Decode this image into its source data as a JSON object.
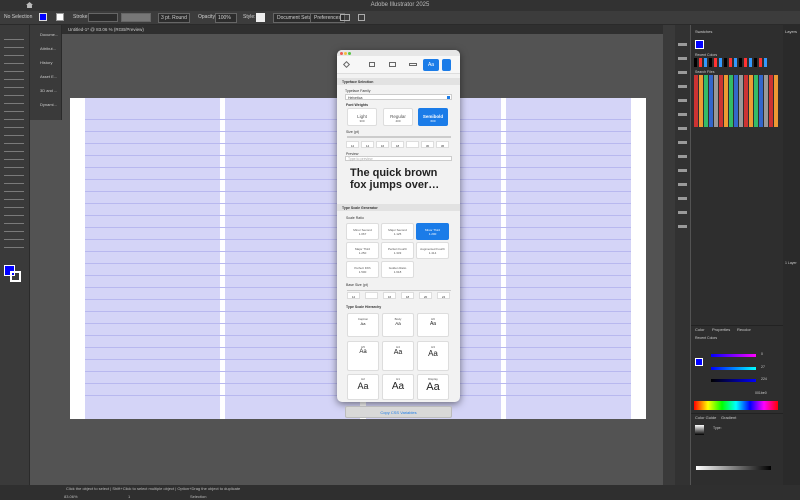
{
  "app": {
    "title": "Adobe Illustrator 2025"
  },
  "control_bar": {
    "selection": "No Selection",
    "stroke_label": "Stroke:",
    "stroke_profile": "3 pt. Round",
    "opacity_label": "Opacity:",
    "opacity_value": "100%",
    "style_label": "Style:",
    "doc_setup": "Document Setup",
    "preferences": "Preferences"
  },
  "doc_tab": {
    "label": "Untitled-1* @ 83.06 % (RGB/Preview)"
  },
  "left_panels": [
    "Docume...",
    "Attribut...",
    "History",
    "Asset E...",
    "3D and ...",
    "Dynami..."
  ],
  "plugin": {
    "section1": "Typeface Selection",
    "family_label": "Typeface Family",
    "family_value": "Helvetica",
    "weights_label": "Font Weights",
    "weights": [
      {
        "name": "Light",
        "val": "300"
      },
      {
        "name": "Regular",
        "val": "400"
      },
      {
        "name": "Semibold",
        "val": "600"
      }
    ],
    "size_label": "Size (pt)",
    "sizes": [
      "12",
      "14",
      "16",
      "18",
      "24",
      "30",
      "36"
    ],
    "preview_label": "Preview",
    "preview_placeholder": "Type to preview",
    "sample": "The quick brown fox jumps over…",
    "section2": "Type Scale Generator",
    "scale_label": "Scale Ratio",
    "ratios": [
      {
        "name": "Minor Second",
        "val": "1.067"
      },
      {
        "name": "Major Second",
        "val": "1.125"
      },
      {
        "name": "Minor Third",
        "val": "1.200"
      },
      {
        "name": "Major Third",
        "val": "1.250"
      },
      {
        "name": "Perfect Fourth",
        "val": "1.333"
      },
      {
        "name": "Augmented Fourth",
        "val": "1.414"
      },
      {
        "name": "Perfect Fifth",
        "val": "1.500"
      },
      {
        "name": "Golden Ratio",
        "val": "1.618"
      }
    ],
    "base_label": "Base Size (pt)",
    "bases": [
      "12",
      "14",
      "16",
      "18",
      "20",
      "24"
    ],
    "hierarchy_label": "Type Scale Hierarchy",
    "levels": [
      "Caption",
      "Body",
      "H6",
      "H5",
      "H4",
      "H3",
      "H2",
      "H1",
      "Display"
    ],
    "sample_small": "Aa",
    "copy_btn": "Copy CSS Variables"
  },
  "right": {
    "swatches_tab": "Swatches",
    "layers_tab": "Layers",
    "recent_colors": "Recent Colors",
    "search": "Search Files",
    "color_tab": "Color",
    "properties_tab": "Properties",
    "recolor_tab": "Recolor",
    "recent2": "Recent Colors",
    "r": "0",
    "g": "27",
    "b": "224",
    "hex": "001be0",
    "guide_tab": "Color Guide",
    "gradient_tab": "Gradient",
    "type_label": "Type:",
    "layer1": "1 Layer"
  },
  "status": {
    "zoom": "83.06%",
    "page": "1",
    "mode": "Selection",
    "hint": "Click the object to select | Shift+Click to select multiple object | Option+Drag the object to duplicate"
  },
  "colors": {
    "accent": "#1b7ce8",
    "grid": "#d4d4f7",
    "fill": "#0000ff"
  }
}
